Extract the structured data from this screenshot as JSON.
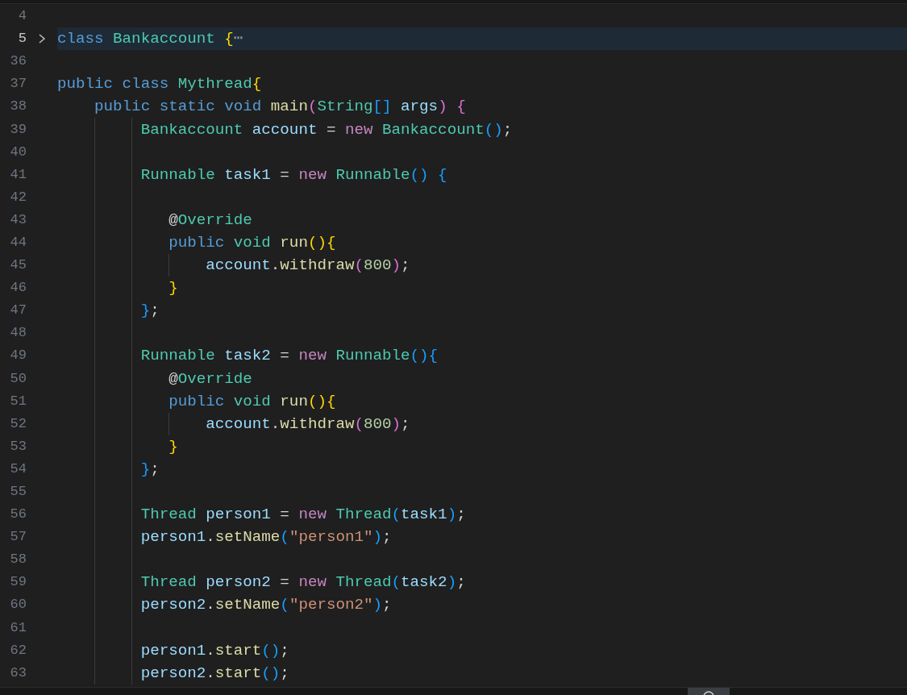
{
  "lines": [
    {
      "number": "4",
      "selected": false
    },
    {
      "number": "5",
      "selected": true,
      "folded": true,
      "tokens": [
        {
          "kind": "kw",
          "text": "class"
        },
        {
          "kind": "type",
          "text": " Bankaccount"
        },
        {
          "kind": "b1",
          "text": " {"
        },
        {
          "kind": "fold",
          "text": "⋯"
        }
      ]
    },
    {
      "number": "36",
      "selected": false
    },
    {
      "number": "37",
      "selected": false,
      "tokens": [
        {
          "kind": "kw",
          "text": "public class"
        },
        {
          "kind": "type",
          "text": " Mythread"
        },
        {
          "kind": "b1",
          "text": "{"
        }
      ]
    },
    {
      "number": "38",
      "selected": false,
      "tokens": [
        {
          "kind": "kw",
          "text": "    public static void"
        },
        {
          "kind": "fn",
          "text": " main"
        },
        {
          "kind": "b2",
          "text": "("
        },
        {
          "kind": "type",
          "text": "String"
        },
        {
          "kind": "b3",
          "text": "[]"
        },
        {
          "kind": "var",
          "text": " args"
        },
        {
          "kind": "b2",
          "text": ")"
        },
        {
          "kind": "b2",
          "text": " {"
        }
      ]
    },
    {
      "number": "39",
      "selected": false,
      "tokens": [
        {
          "kind": "type",
          "text": "         Bankaccount"
        },
        {
          "kind": "var",
          "text": " account"
        },
        {
          "kind": "p",
          "text": " ="
        },
        {
          "kind": "ctl",
          "text": " new"
        },
        {
          "kind": "type",
          "text": " Bankaccount"
        },
        {
          "kind": "b3",
          "text": "()"
        },
        {
          "kind": "p",
          "text": ";"
        }
      ]
    },
    {
      "number": "40",
      "selected": false
    },
    {
      "number": "41",
      "selected": false,
      "tokens": [
        {
          "kind": "type",
          "text": "         Runnable"
        },
        {
          "kind": "var",
          "text": " task1"
        },
        {
          "kind": "p",
          "text": " ="
        },
        {
          "kind": "ctl",
          "text": " new"
        },
        {
          "kind": "type",
          "text": " Runnable"
        },
        {
          "kind": "b3",
          "text": "()"
        },
        {
          "kind": "b3",
          "text": " {"
        }
      ]
    },
    {
      "number": "42",
      "selected": false
    },
    {
      "number": "43",
      "selected": false,
      "tokens": [
        {
          "kind": "p",
          "text": "            @"
        },
        {
          "kind": "type",
          "text": "Override"
        }
      ]
    },
    {
      "number": "44",
      "selected": false,
      "tokens": [
        {
          "kind": "kw",
          "text": "            public"
        },
        {
          "kind": "type",
          "text": " void"
        },
        {
          "kind": "fn",
          "text": " run"
        },
        {
          "kind": "b1",
          "text": "(){"
        }
      ]
    },
    {
      "number": "45",
      "selected": false,
      "tokens": [
        {
          "kind": "var",
          "text": "                account"
        },
        {
          "kind": "p",
          "text": "."
        },
        {
          "kind": "fn",
          "text": "withdraw"
        },
        {
          "kind": "b2",
          "text": "("
        },
        {
          "kind": "num",
          "text": "800"
        },
        {
          "kind": "b2",
          "text": ")"
        },
        {
          "kind": "p",
          "text": ";"
        }
      ]
    },
    {
      "number": "46",
      "selected": false,
      "tokens": [
        {
          "kind": "b1",
          "text": "            }"
        }
      ]
    },
    {
      "number": "47",
      "selected": false,
      "tokens": [
        {
          "kind": "b3",
          "text": "         }"
        },
        {
          "kind": "p",
          "text": ";"
        }
      ]
    },
    {
      "number": "48",
      "selected": false
    },
    {
      "number": "49",
      "selected": false,
      "tokens": [
        {
          "kind": "type",
          "text": "         Runnable"
        },
        {
          "kind": "var",
          "text": " task2"
        },
        {
          "kind": "p",
          "text": " ="
        },
        {
          "kind": "ctl",
          "text": " new"
        },
        {
          "kind": "type",
          "text": " Runnable"
        },
        {
          "kind": "b3",
          "text": "(){"
        }
      ]
    },
    {
      "number": "50",
      "selected": false,
      "tokens": [
        {
          "kind": "p",
          "text": "            @"
        },
        {
          "kind": "type",
          "text": "Override"
        }
      ]
    },
    {
      "number": "51",
      "selected": false,
      "tokens": [
        {
          "kind": "kw",
          "text": "            public"
        },
        {
          "kind": "type",
          "text": " void"
        },
        {
          "kind": "fn",
          "text": " run"
        },
        {
          "kind": "b1",
          "text": "(){"
        }
      ]
    },
    {
      "number": "52",
      "selected": false,
      "tokens": [
        {
          "kind": "var",
          "text": "                account"
        },
        {
          "kind": "p",
          "text": "."
        },
        {
          "kind": "fn",
          "text": "withdraw"
        },
        {
          "kind": "b2",
          "text": "("
        },
        {
          "kind": "num",
          "text": "800"
        },
        {
          "kind": "b2",
          "text": ")"
        },
        {
          "kind": "p",
          "text": ";"
        }
      ]
    },
    {
      "number": "53",
      "selected": false,
      "tokens": [
        {
          "kind": "b1",
          "text": "            }"
        }
      ]
    },
    {
      "number": "54",
      "selected": false,
      "tokens": [
        {
          "kind": "b3",
          "text": "         }"
        },
        {
          "kind": "p",
          "text": ";"
        }
      ]
    },
    {
      "number": "55",
      "selected": false
    },
    {
      "number": "56",
      "selected": false,
      "tokens": [
        {
          "kind": "type",
          "text": "         Thread"
        },
        {
          "kind": "var",
          "text": " person1"
        },
        {
          "kind": "p",
          "text": " ="
        },
        {
          "kind": "ctl",
          "text": " new"
        },
        {
          "kind": "type",
          "text": " Thread"
        },
        {
          "kind": "b3",
          "text": "("
        },
        {
          "kind": "var",
          "text": "task1"
        },
        {
          "kind": "b3",
          "text": ")"
        },
        {
          "kind": "p",
          "text": ";"
        }
      ]
    },
    {
      "number": "57",
      "selected": false,
      "tokens": [
        {
          "kind": "var",
          "text": "         person1"
        },
        {
          "kind": "p",
          "text": "."
        },
        {
          "kind": "fn",
          "text": "setName"
        },
        {
          "kind": "b3",
          "text": "("
        },
        {
          "kind": "str",
          "text": "\"person1\""
        },
        {
          "kind": "b3",
          "text": ")"
        },
        {
          "kind": "p",
          "text": ";"
        }
      ]
    },
    {
      "number": "58",
      "selected": false
    },
    {
      "number": "59",
      "selected": false,
      "tokens": [
        {
          "kind": "type",
          "text": "         Thread"
        },
        {
          "kind": "var",
          "text": " person2"
        },
        {
          "kind": "p",
          "text": " ="
        },
        {
          "kind": "ctl",
          "text": " new"
        },
        {
          "kind": "type",
          "text": " Thread"
        },
        {
          "kind": "b3",
          "text": "("
        },
        {
          "kind": "var",
          "text": "task2"
        },
        {
          "kind": "b3",
          "text": ")"
        },
        {
          "kind": "p",
          "text": ";"
        }
      ]
    },
    {
      "number": "60",
      "selected": false,
      "tokens": [
        {
          "kind": "var",
          "text": "         person2"
        },
        {
          "kind": "p",
          "text": "."
        },
        {
          "kind": "fn",
          "text": "setName"
        },
        {
          "kind": "b3",
          "text": "("
        },
        {
          "kind": "str",
          "text": "\"person2\""
        },
        {
          "kind": "b3",
          "text": ")"
        },
        {
          "kind": "p",
          "text": ";"
        }
      ]
    },
    {
      "number": "61",
      "selected": false
    },
    {
      "number": "62",
      "selected": false,
      "tokens": [
        {
          "kind": "var",
          "text": "         person1"
        },
        {
          "kind": "p",
          "text": "."
        },
        {
          "kind": "fn",
          "text": "start"
        },
        {
          "kind": "b3",
          "text": "()"
        },
        {
          "kind": "p",
          "text": ";"
        }
      ]
    },
    {
      "number": "63",
      "selected": false,
      "tokens": [
        {
          "kind": "var",
          "text": "         person2"
        },
        {
          "kind": "p",
          "text": "."
        },
        {
          "kind": "fn",
          "text": "start"
        },
        {
          "kind": "b3",
          "text": "()"
        },
        {
          "kind": "p",
          "text": ";"
        }
      ]
    }
  ]
}
